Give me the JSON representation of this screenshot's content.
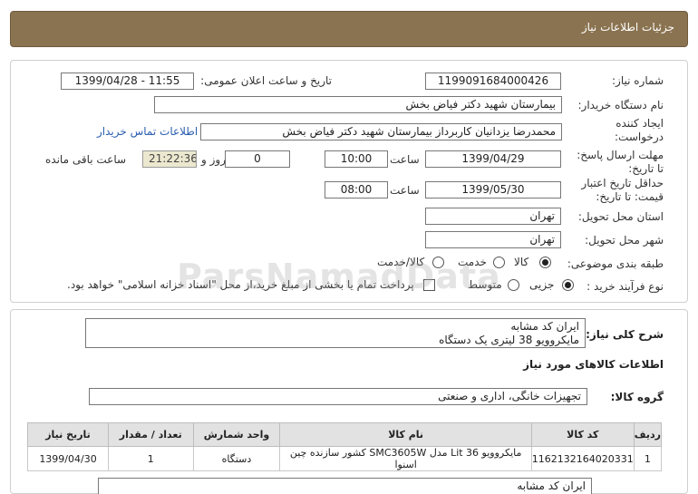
{
  "header": {
    "title": "جزئیات اطلاعات نیاز"
  },
  "form": {
    "need_number_label": "شماره نیاز:",
    "need_number": "1199091684000426",
    "announce_label": "تاریخ و ساعت اعلان عمومی:",
    "announce_value": "1399/04/28 - 11:55",
    "buyer_org_label": "نام دستگاه خریدار:",
    "buyer_org": "بیمارستان شهید دکتر فیاض بخش",
    "requester_label_1": "ایجاد کننده",
    "requester_label_2": "درخواست:",
    "requester": "محمدرضا یزدانیان کاربرداز بیمارستان شهید دکتر فیاض بخش",
    "contact_link": "اطلاعات تماس خریدار",
    "deadline_label_1": "مهلت ارسال پاسخ:",
    "deadline_label_2": "تا تاریخ:",
    "deadline_date": "1399/04/29",
    "time_label": "ساعت",
    "deadline_time": "10:00",
    "days_value": "0",
    "days_label": "روز و",
    "remaining_time": "21:22:36",
    "remaining_label": "ساعت باقی مانده",
    "validity_label_1": "حداقل تاریخ اعتبار",
    "validity_label_2": "قیمت: تا تاریخ:",
    "validity_date": "1399/05/30",
    "validity_time": "08:00",
    "province_label": "استان محل تحویل:",
    "province": "تهران",
    "city_label": "شهر محل تحویل:",
    "city": "تهران",
    "category_label": "طبقه بندی موضوعی:",
    "category_options": [
      "کالا",
      "خدمت",
      "کالا/خدمت"
    ],
    "category_selected": "کالا",
    "process_label": "نوع فرآیند خرید :",
    "process_options": [
      "جزیی",
      "متوسط"
    ],
    "process_selected": "جزیی",
    "payment_note": "پرداخت تمام یا بخشی از مبلغ خرید،از محل \"اسناد خزانه اسلامی\" خواهد بود."
  },
  "details": {
    "description_label": "شرح کلی نیاز:",
    "description_line1": "ایران کد مشابه",
    "description_line2": "مایکروویو 38 لیتری یک دستگاه",
    "goods_info_heading": "اطلاعات کالاهای مورد نیاز",
    "group_label": "گروه کالا:",
    "group_value": "تجهیزات خانگی، اداری و صنعتی"
  },
  "table": {
    "headers": [
      "ردیف",
      "کد کالا",
      "نام کالا",
      "واحد شمارش",
      "تعداد / مقدار",
      "تاریخ نیاز"
    ],
    "rows": [
      [
        "1",
        "1162132164020331",
        "مایکروویو Lit 36 مدل SMC3605W کشور سازنده چین اسنوا",
        "دستگاه",
        "1",
        "1399/04/30"
      ]
    ]
  },
  "footer_note": "ایران کد مشابه",
  "watermark": {
    "line1": "ParsNamadData",
    "line2": "۰۲۱-۸۸۳۴۹۶۷۰-۵"
  },
  "colors": {
    "header_bg": "#8a7350",
    "remaining_bg": "#ece8cf",
    "link": "#2a5db0"
  }
}
